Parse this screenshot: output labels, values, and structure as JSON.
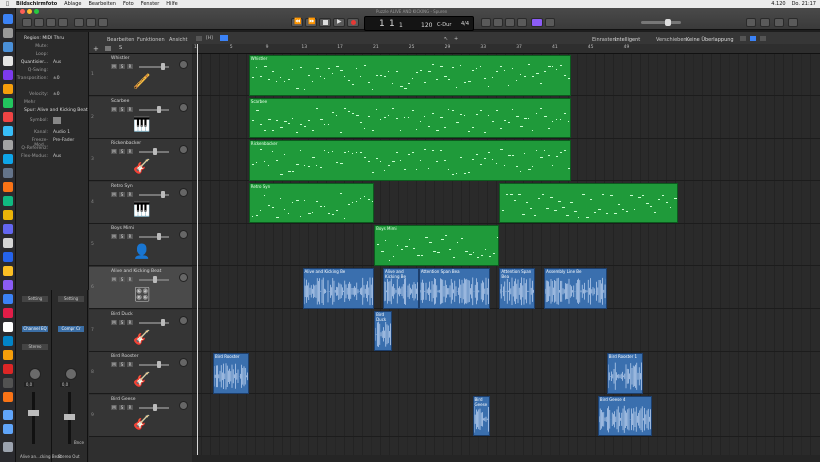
{
  "menubar": {
    "app": "Bildschirmfoto",
    "items": [
      "Ablage",
      "Bearbeiten",
      "Foto",
      "Fenster",
      "Hilfe"
    ],
    "status": [
      "4.120",
      "Do. 21:17"
    ]
  },
  "title": "Puzzle ALIVE AND KICKING - Spuren",
  "lcd": {
    "bar": "1",
    "beat": "1",
    "div": "1",
    "tempo": "120",
    "key": "C-Dur",
    "sig": "4/4"
  },
  "toolbar_right": {
    "einrasten_label": "Einrasten:",
    "einrasten_value": "Intelligent",
    "verschieben_label": "Verschieben:",
    "verschieben_value": "Keine Überlappung"
  },
  "menus": {
    "bearbeiten": "Bearbeiten",
    "funktionen": "Funktionen",
    "ansicht": "Ansicht"
  },
  "inspector": {
    "region": "Region: MIDI Thru",
    "rows": [
      {
        "label": "Mute:",
        "value": ""
      },
      {
        "label": "Loop:",
        "value": ""
      },
      {
        "label": "Quantisier...",
        "value": "Aus"
      },
      {
        "label": "Q-Swing:",
        "value": ""
      },
      {
        "label": "Transposition:",
        "value": "±0"
      },
      {
        "label": "Velocity:",
        "value": "±0"
      }
    ],
    "more": "Mehr",
    "spur": "Spur: Alive and Kicking Beat",
    "spur_rows": [
      {
        "label": "Symbol:",
        "value": ""
      },
      {
        "label": "Kanal:",
        "value": "Audio 1"
      },
      {
        "label": "Freeze-Mod...",
        "value": "Pre-Fader"
      },
      {
        "label": "Q-Referenz:",
        "value": ""
      },
      {
        "label": "Flex-Modus:",
        "value": "Aus"
      }
    ]
  },
  "mixer": {
    "strip1_setting": "Setting",
    "strip1_eq": "Channel EQ",
    "strip1_label": "Stereo",
    "strip1_name": "Alive an...cking Beat",
    "strip1_value": "0,0",
    "strip2_setting": "Setting",
    "strip2_eq": "Compr Cr",
    "strip2_name": "Stereo Out",
    "strip2_value": "0,0",
    "bnce": "Bnce"
  },
  "ruler": [
    "1",
    "5",
    "9",
    "13",
    "17",
    "21",
    "25",
    "29",
    "33",
    "37",
    "41",
    "45",
    "49"
  ],
  "tracks": [
    {
      "num": "1",
      "name": "Whistler",
      "icon": "🪈",
      "kind": "midi"
    },
    {
      "num": "2",
      "name": "Scarbee",
      "icon": "🎹",
      "kind": "midi"
    },
    {
      "num": "3",
      "name": "Rickenbacker",
      "icon": "🎸",
      "kind": "midi"
    },
    {
      "num": "4",
      "name": "Retro Syn",
      "icon": "🎹",
      "kind": "midi"
    },
    {
      "num": "5",
      "name": "Boys Mimi",
      "icon": "👤",
      "kind": "midi"
    },
    {
      "num": "6",
      "name": "Alive and Kicking Beat",
      "icon": "🎛",
      "kind": "audio"
    },
    {
      "num": "7",
      "name": "Bird Duck",
      "icon": "🎸",
      "kind": "audio"
    },
    {
      "num": "8",
      "name": "Bird Rooster",
      "icon": "🎸",
      "kind": "audio"
    },
    {
      "num": "9",
      "name": "Bird Geese",
      "icon": "🎸",
      "kind": "audio"
    }
  ],
  "regions": [
    {
      "track": 0,
      "kind": "midi",
      "name": "Whistler",
      "start": 5,
      "end": 41
    },
    {
      "track": 1,
      "kind": "midi",
      "name": "Scarbee",
      "start": 5,
      "end": 41
    },
    {
      "track": 2,
      "kind": "midi",
      "name": "Rickenbacker",
      "start": 5,
      "end": 41
    },
    {
      "track": 3,
      "kind": "midi",
      "name": "Retro Syn",
      "start": 5,
      "end": 19
    },
    {
      "track": 3,
      "kind": "midi",
      "name": "",
      "start": 33,
      "end": 53
    },
    {
      "track": 4,
      "kind": "midi",
      "name": "Boys Mimi",
      "start": 19,
      "end": 33
    },
    {
      "track": 5,
      "kind": "audio",
      "name": "Alive and Kicking Be",
      "start": 11,
      "end": 19
    },
    {
      "track": 5,
      "kind": "audio",
      "name": "Alive and Kicking Be",
      "start": 20,
      "end": 24
    },
    {
      "track": 5,
      "kind": "audio",
      "name": "Attention Span Bea",
      "start": 24,
      "end": 32
    },
    {
      "track": 5,
      "kind": "audio",
      "name": "Attention Span Bea",
      "start": 33,
      "end": 37
    },
    {
      "track": 5,
      "kind": "audio",
      "name": "Assembly Line Be",
      "start": 38,
      "end": 45
    },
    {
      "track": 6,
      "kind": "audio",
      "name": "Bird Duck",
      "start": 19,
      "end": 21
    },
    {
      "track": 7,
      "kind": "audio",
      "name": "Bird Rooster",
      "start": 1,
      "end": 5
    },
    {
      "track": 7,
      "kind": "audio",
      "name": "Bird Rooster 1",
      "start": 45,
      "end": 49
    },
    {
      "track": 8,
      "kind": "audio",
      "name": "Bird Geese",
      "start": 30,
      "end": 32
    },
    {
      "track": 8,
      "kind": "audio",
      "name": "Bird Geese 4",
      "start": 44,
      "end": 50
    }
  ]
}
